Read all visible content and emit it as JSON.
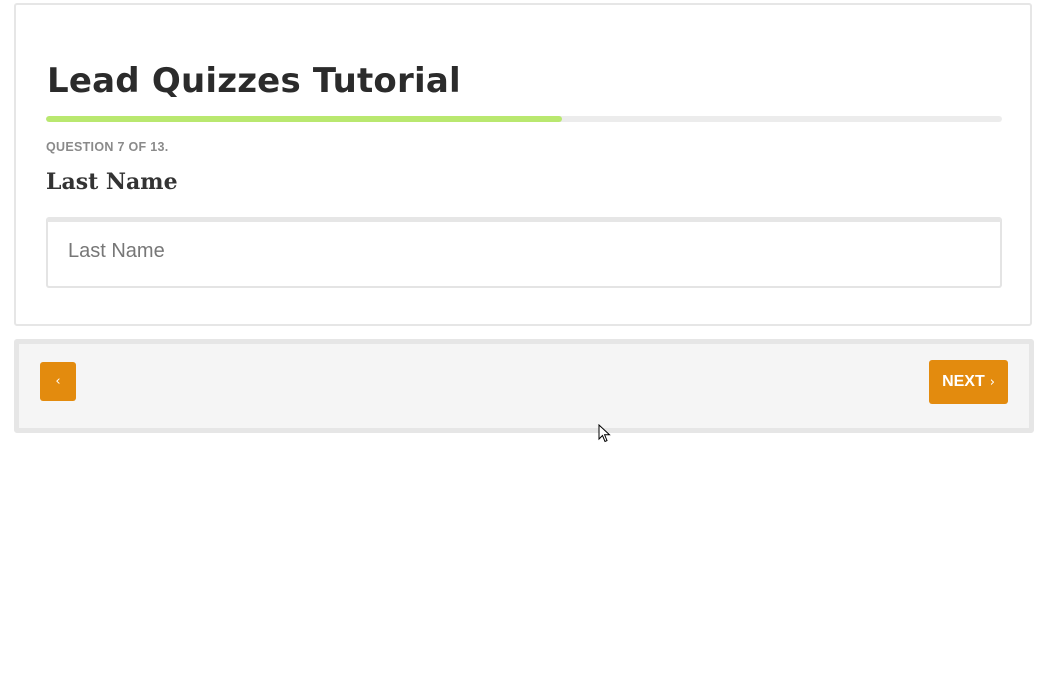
{
  "quiz": {
    "title": "Lead Quizzes Tutorial",
    "progress_fraction": 0.54,
    "counter": "QUESTION 7 OF 13.",
    "question": "Last Name",
    "input": {
      "value": "",
      "placeholder": "Last Name"
    }
  },
  "nav": {
    "back_icon": "chevron-left-icon",
    "back_glyph": "‹",
    "next_label": "NEXT",
    "next_icon": "chevron-right-icon",
    "next_glyph": "›"
  },
  "colors": {
    "accent": "#e38b0e",
    "progress": "#b9e86f",
    "progress_track": "#ececec",
    "nav_background": "#f5f5f5",
    "title_text": "#2b2b2b",
    "counter_text": "#8a8a8a"
  },
  "cursor_icon": "mouse-pointer-icon"
}
